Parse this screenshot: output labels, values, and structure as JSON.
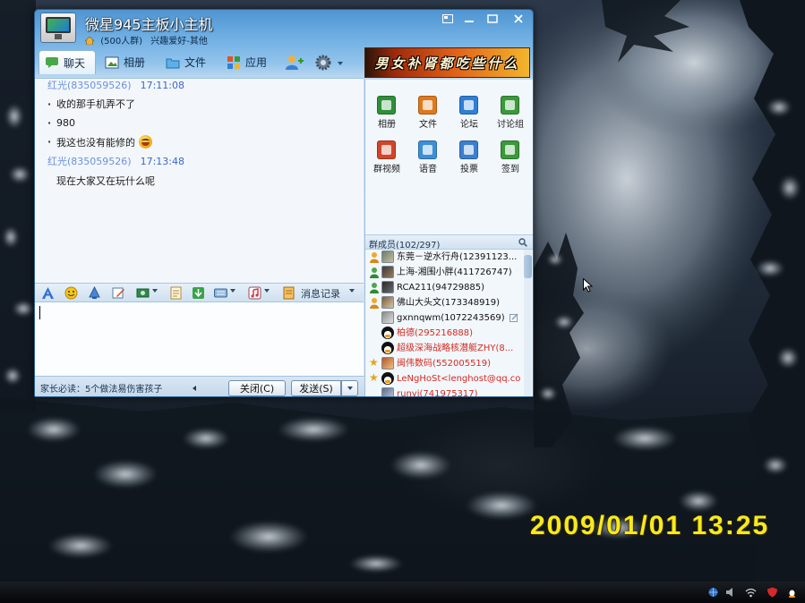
{
  "window": {
    "title": "微星945主板小主机",
    "member_count": "(500人群)",
    "category": "兴趣爱好-其他",
    "avatar_icon": "monitor-icon",
    "controls": [
      "skin-icon",
      "minimize-icon",
      "maximize-icon",
      "close-icon"
    ]
  },
  "tabs": [
    {
      "label": "聊天",
      "icon": "chat-icon",
      "active": true
    },
    {
      "label": "相册",
      "icon": "album-icon",
      "active": false
    },
    {
      "label": "文件",
      "icon": "folder-icon",
      "active": false
    },
    {
      "label": "应用",
      "icon": "apps-icon",
      "active": false
    }
  ],
  "tab_extras": [
    "add-member-icon",
    "settings-gear-icon"
  ],
  "ad_banner": {
    "text": "男女补肾都吃些什么"
  },
  "messages": [
    {
      "sender": "红光(835059526)",
      "time": "17:11:08"
    },
    {
      "text": "收的那手机弄不了"
    },
    {
      "text": "980"
    },
    {
      "text": "我这也没有能修的",
      "emoji": "grin-emoji-icon"
    },
    {
      "sender": "红光(835059526)",
      "time": "17:13:48"
    },
    {
      "text": "现在大家又在玩什么呢"
    }
  ],
  "toolbar": {
    "icons": [
      "font-icon",
      "emoticon-icon",
      "shake-icon",
      "doodle-icon",
      "screenshot-icon",
      "document-icon",
      "image-icon",
      "keyboard-icon",
      "music-icon",
      "history-icon"
    ],
    "history_label": "消息记录"
  },
  "input": {
    "value": ""
  },
  "footer": {
    "notice": "家长必读：5个做法易伤害孩子",
    "close_label": "关闭(C)",
    "send_label": "发送(S)"
  },
  "apps": [
    {
      "label": "相册",
      "icon": "album-icon",
      "color": "#2f8f3a"
    },
    {
      "label": "文件",
      "icon": "file-icon",
      "color": "#e0781c"
    },
    {
      "label": "论坛",
      "icon": "forum-icon",
      "color": "#2f7fd6"
    },
    {
      "label": "讨论组",
      "icon": "discussion-icon",
      "color": "#3a9a3a"
    },
    {
      "label": "群视频",
      "icon": "group-video-icon",
      "color": "#d2452a"
    },
    {
      "label": "语音",
      "icon": "voice-icon",
      "color": "#3b8fd8"
    },
    {
      "label": "投票",
      "icon": "vote-icon",
      "color": "#3b7fd0"
    },
    {
      "label": "签到",
      "icon": "check-in-icon",
      "color": "#3a9a3a"
    }
  ],
  "members_panel": {
    "header": "群成员(102/297)"
  },
  "members": [
    {
      "name": "东莞－逆水行舟(12391123...",
      "badge": "admin",
      "color": "#111111"
    },
    {
      "name": "上海-湘围小胖(411726747)",
      "badge": "admin",
      "color": "#111111"
    },
    {
      "name": "RCA211(94729885)",
      "badge": "admin",
      "color": "#111111"
    },
    {
      "name": "佛山大头文(173348919)",
      "badge": "admin",
      "color": "#111111"
    },
    {
      "name": "gxnnqwm(1072243569)",
      "badge": "",
      "color": "#111111"
    },
    {
      "name": "柏德(295216888)",
      "badge": "",
      "color": "#d42a1e"
    },
    {
      "name": "超级深海战略核潜艇ZHY(8...",
      "badge": "",
      "color": "#d42a1e"
    },
    {
      "name": "闽伟数码(552005519)",
      "badge": "star",
      "color": "#d42a1e"
    },
    {
      "name": "LeNgHoSt<lenghost@qq.com>",
      "badge": "star",
      "color": "#d42a1e"
    },
    {
      "name": "runyi(741975317)",
      "badge": "",
      "color": "#d42a1e"
    }
  ],
  "camera_timestamp": "2009/01/01 13:25",
  "colors": {
    "title_bar": "#4f95d2",
    "sender": "#6b8fe0",
    "time": "#3a66cc",
    "highlight_member": "#d42a1e",
    "timestamp": "#f7ea1c"
  }
}
